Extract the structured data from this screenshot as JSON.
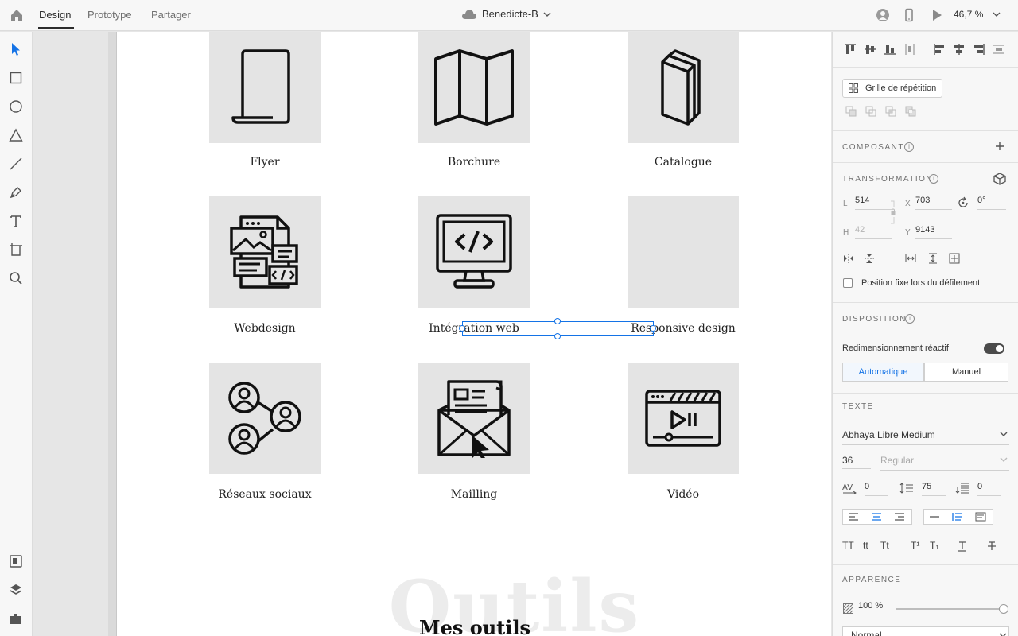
{
  "topbar": {
    "tabs": [
      {
        "label": "Design"
      },
      {
        "label": "Prototype"
      },
      {
        "label": "Partager"
      }
    ],
    "document_title": "Benedicte-B",
    "zoom": "46,7 %"
  },
  "artboard": {
    "services": [
      {
        "label": "Flyer",
        "icon": "flyer-icon"
      },
      {
        "label": "Borchure",
        "icon": "brochure-map-icon"
      },
      {
        "label": "Catalogue",
        "icon": "catalogue-icon"
      },
      {
        "label": "Webdesign",
        "icon": "webdesign-icon"
      },
      {
        "label": "Intégration web",
        "icon": "monitor-code-icon"
      },
      {
        "label": "Responsive design",
        "icon": ""
      },
      {
        "label": "Réseaux sociaux",
        "icon": "social-network-icon"
      },
      {
        "label": "Mailling",
        "icon": "mail-newsletter-icon"
      },
      {
        "label": "Vidéo",
        "icon": "video-player-icon"
      }
    ],
    "watermark": "Outils",
    "heading": "Mes outils"
  },
  "panel": {
    "repeat_grid_label": "Grille de répétition",
    "component_title": "COMPOSANT",
    "transform_title": "TRANSFORMATION",
    "width_label": "L",
    "width_value": "514",
    "x_label": "X",
    "x_value": "703",
    "rotation_value": "0°",
    "height_label": "H",
    "height_value": "42",
    "y_label": "Y",
    "y_value": "9143",
    "fixed_position_label": "Position fixe lors du défilement",
    "layout_title": "DISPOSITION",
    "responsive_resize_label": "Redimensionnement réactif",
    "responsive_resize_on": true,
    "mode_auto": "Automatique",
    "mode_manual": "Manuel",
    "text_title": "TEXTE",
    "font_family": "Abhaya Libre Medium",
    "font_size": "36",
    "font_weight": "Regular",
    "char_spacing": "0",
    "line_spacing": "75",
    "paragraph_spacing": "0",
    "case_uppercase": "TT",
    "case_lowercase": "tt",
    "case_titlecase": "Tt",
    "superscript": "T¹",
    "subscript": "T₁",
    "appearance_title": "APPARENCE",
    "opacity": "100 %",
    "blend_mode": "Normal",
    "accent_color": "#1473e6"
  }
}
